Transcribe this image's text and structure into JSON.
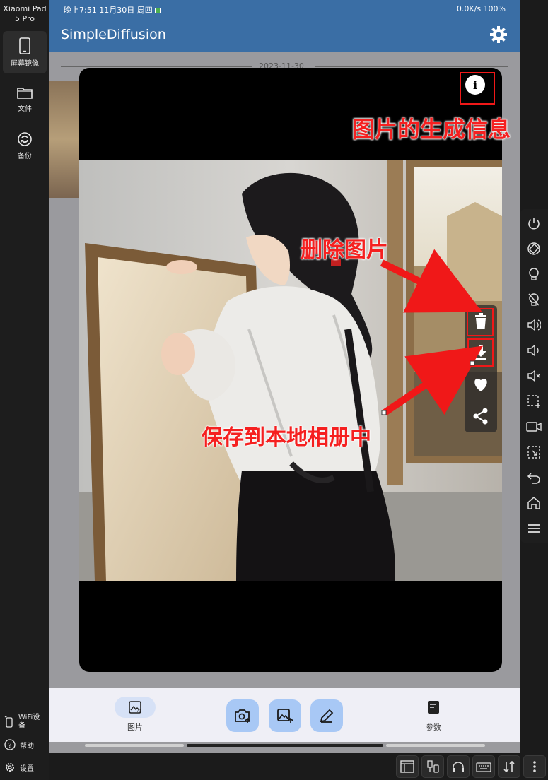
{
  "left_sidebar": {
    "device_name": "Xiaomi Pad 5 Pro",
    "items": [
      {
        "label": "屏幕镜像",
        "icon": "phone-icon"
      },
      {
        "label": "文件",
        "icon": "folder-icon"
      },
      {
        "label": "备份",
        "icon": "sync-icon"
      }
    ],
    "bottom": [
      {
        "label": "WiFi设备",
        "icon": "wifi-device-icon"
      },
      {
        "label": "帮助",
        "icon": "help-icon"
      },
      {
        "label": "设置",
        "icon": "gear-icon"
      }
    ]
  },
  "statusbar": {
    "left": "晚上7:51 11月30日 周四",
    "right": "0.0K/s 100%"
  },
  "app": {
    "title": "SimpleDiffusion",
    "date_header": "2023-11-30"
  },
  "viewer": {
    "info_glyph": "i",
    "actions": [
      "delete-icon",
      "download-icon",
      "heart-icon",
      "share-icon"
    ]
  },
  "annotations": {
    "info": "图片的生成信息",
    "delete": "删除图片",
    "save": "保存到本地相册中"
  },
  "bottom_nav": {
    "left_label": "图片",
    "right_label": "参数",
    "center_actions": [
      "camera-upload-icon",
      "image-upload-icon",
      "edit-icon"
    ]
  },
  "colors": {
    "appbar": "#3a6ea5",
    "annotation": "#f52020",
    "fab": "#a8c8f5"
  }
}
